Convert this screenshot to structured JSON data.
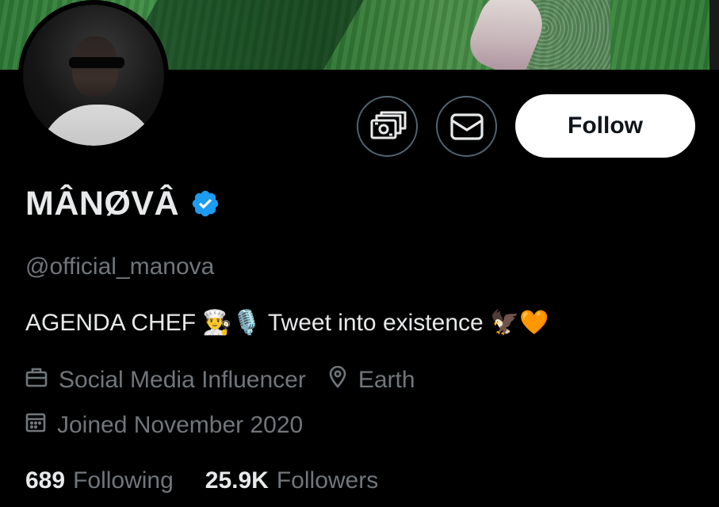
{
  "profile": {
    "display_name": "MÂNØVÂ",
    "verified": true,
    "handle": "@official_manova",
    "bio": "AGENDA CHEF 👨‍🍳🎙️ Tweet into existence 🦅🧡",
    "category": "Social Media Influencer",
    "location": "Earth",
    "joined": "Joined November 2020"
  },
  "actions": {
    "follow_label": "Follow",
    "tip_icon": "money-tip-icon",
    "message_icon": "envelope-icon"
  },
  "stats": {
    "following_count": "689",
    "following_label": "Following",
    "followers_count": "25.9K",
    "followers_label": "Followers"
  },
  "icons": {
    "verified": "verified-badge-icon",
    "category": "briefcase-icon",
    "location": "location-pin-icon",
    "joined": "calendar-icon"
  },
  "colors": {
    "background": "#000000",
    "text_primary": "#e7e9ea",
    "text_secondary": "#71767b",
    "verified_blue": "#1d9bf0",
    "button_border": "#536471",
    "follow_bg": "#ffffff",
    "follow_text": "#0f1419"
  }
}
